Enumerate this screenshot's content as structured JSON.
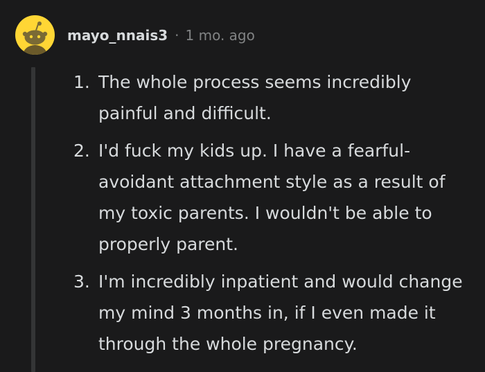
{
  "comment": {
    "username": "mayo_nnais3",
    "separator": "·",
    "timestamp": "1 mo. ago",
    "items": [
      {
        "number": "1.",
        "text": "The whole process seems incredibly painful and difficult."
      },
      {
        "number": "2.",
        "text": "I'd fuck my kids up. I have a fearful-avoidant attachment style as a result of my toxic parents. I wouldn't be able to properly parent."
      },
      {
        "number": "3.",
        "text": "I'm incredibly inpatient and would change my mind 3 months in, if I even made it through the whole pregnancy."
      }
    ]
  },
  "colors": {
    "background": "#1a1a1b",
    "text": "#d7dadc",
    "muted": "#818384",
    "avatar_bg": "#ffd635",
    "thread_line": "#343536"
  },
  "icons": {
    "avatar": "reddit-snoo-avatar-icon"
  }
}
